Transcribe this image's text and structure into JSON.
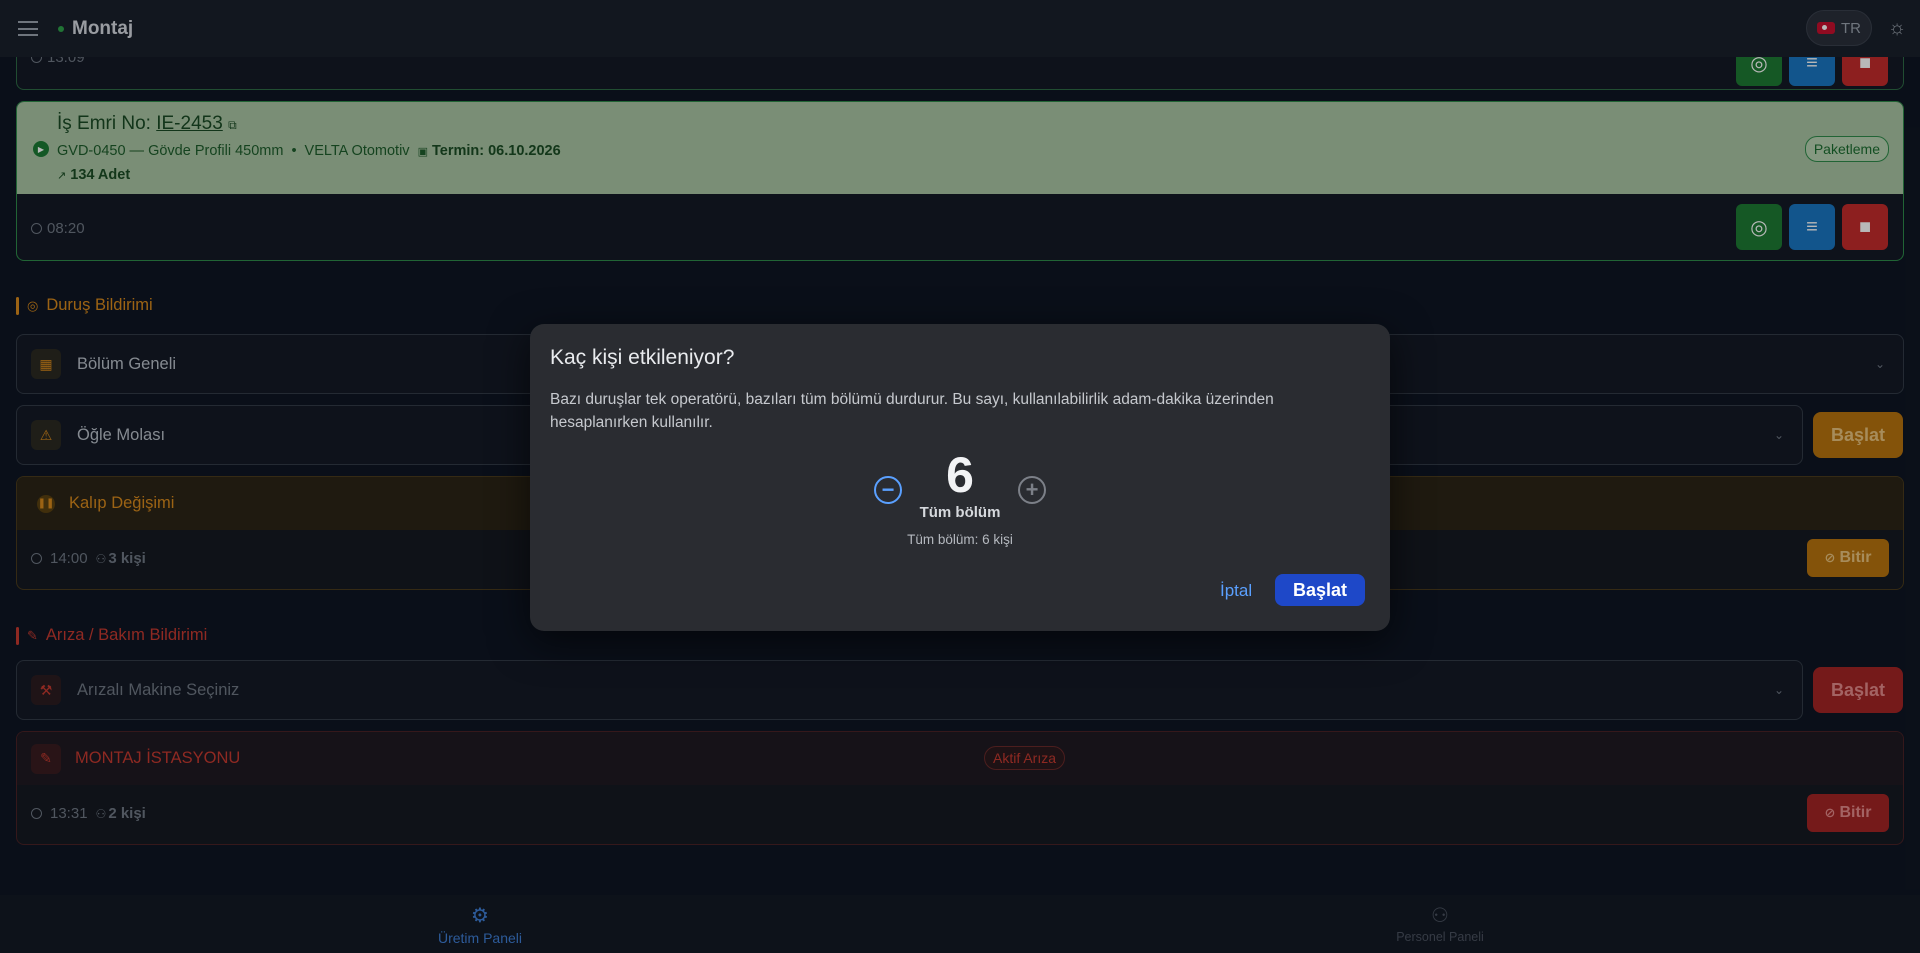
{
  "header": {
    "title": "Montaj",
    "lang": "TR"
  },
  "prev_card": {
    "time": "13:09"
  },
  "work_order": {
    "label": "İş Emri No:",
    "number": "IE-2453",
    "product": "GVD-0450 — Gövde Profili 450mm",
    "separator": "•",
    "customer": "VELTA Otomotiv",
    "due": "Termin: 06.10.2026",
    "qty": "134 Adet",
    "stage": "Paketleme",
    "time": "08:20"
  },
  "downtime": {
    "title": "Duruş Bildirimi",
    "scope_value": "Bölüm Geneli",
    "reason_value": "Öğle Molası",
    "start_label": "Başlat",
    "active": {
      "name": "Kalıp Değişimi",
      "time": "14:00",
      "people": "3 kişi",
      "finish_label": "Bitir"
    }
  },
  "fault": {
    "title": "Arıza / Bakım Bildirimi",
    "machine_placeholder": "Arızalı Makine Seçiniz",
    "start_label": "Başlat",
    "active": {
      "name": "MONTAJ İSTASYONU",
      "badge": "Aktif Arıza",
      "time": "13:31",
      "people": "2 kişi",
      "finish_label": "Bitir"
    }
  },
  "bottom_nav": {
    "production": "Üretim Paneli",
    "personnel": "Personel Paneli"
  },
  "dialog": {
    "title": "Kaç kişi etkileniyor?",
    "description": "Bazı duruşlar tek operatörü, bazıları tüm bölümü durdurur. Bu sayı, kullanılabilirlik adam-dakika üzerinden hesaplanırken kullanılır.",
    "count": "6",
    "count_label": "Tüm bölüm",
    "count_sub": "Tüm bölüm: 6 kişi",
    "cancel": "İptal",
    "confirm": "Başlat"
  },
  "colors": {
    "accent_blue": "#1e48c8",
    "success": "#1e7a34",
    "warning": "#d98a1c",
    "danger": "#c63a30"
  }
}
